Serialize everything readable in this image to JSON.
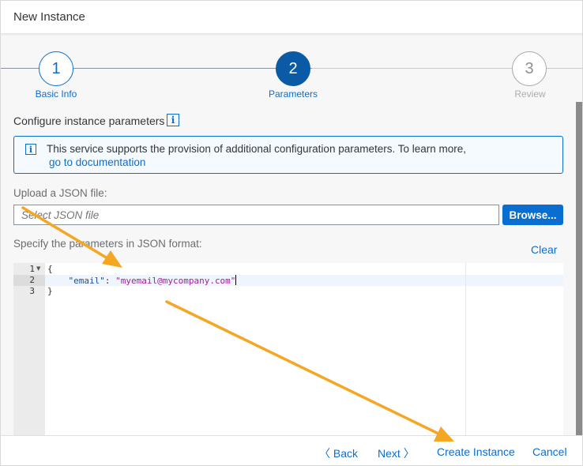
{
  "dialog": {
    "title": "New Instance"
  },
  "wizard": {
    "steps": [
      {
        "number": "1",
        "label": "Basic Info",
        "state": "completed"
      },
      {
        "number": "2",
        "label": "Parameters",
        "state": "current"
      },
      {
        "number": "3",
        "label": "Review",
        "state": "upcoming"
      }
    ]
  },
  "content": {
    "section_title": "Configure instance parameters",
    "info_box": {
      "text": "This service supports the provision of additional configuration parameters. To learn more,",
      "link": "go to documentation"
    },
    "upload": {
      "label": "Upload a JSON file:",
      "placeholder": "Select JSON file",
      "browse_label": "Browse..."
    },
    "editor": {
      "label": "Specify the parameters in JSON format:",
      "clear_label": "Clear",
      "line_numbers": [
        "1",
        "2",
        "3"
      ],
      "lines": {
        "open_brace": "{",
        "key": "\"email\"",
        "colon": ": ",
        "value": "\"myemail@mycompany.com\"",
        "close_brace": "}"
      }
    }
  },
  "footer": {
    "back_label": "Back",
    "next_label": "Next",
    "create_label": "Create Instance",
    "cancel_label": "Cancel"
  },
  "colors": {
    "accent": "#0a6ed1",
    "current_step": "#0b5aa5",
    "annotation_arrow": "#f5a623"
  }
}
